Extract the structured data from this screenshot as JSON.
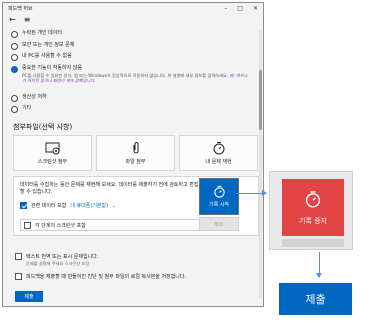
{
  "window": {
    "title": "피드백 허브",
    "controls": [
      "–",
      "□",
      "✕"
    ]
  },
  "nav": {
    "back_icon": "back-arrow-icon",
    "menu_icon": "hamburger-icon"
  },
  "severity": {
    "options": [
      {
        "label": "누락된 개인 데이터",
        "selected": false
      },
      {
        "label": "보안 또는 개인 정보 문제",
        "selected": false
      },
      {
        "label": "내 PC를 사용할 수 없음",
        "selected": false
      },
      {
        "label": "중요한 기능이 작동하지 않음",
        "selected": true,
        "desc": "PC를 사용할 수 있지만 장치, 앱 또는 Windows가 정상적으로 작동하지 않습니다. 위 설명에 세부 정보를 입력하세요.",
        "desc_link": "예: 마우스가 커지지 않거나 화면이 계속 깜빡입니다."
      },
      {
        "label": "생산성 저하",
        "selected": false
      },
      {
        "label": "기타",
        "selected": false
      }
    ]
  },
  "attachments": {
    "title": "첨부파일(선택 사항)",
    "buttons": [
      {
        "label": "스크린샷 첨부",
        "icon": "screenshot-icon"
      },
      {
        "label": "파일 첨부",
        "icon": "file-attach-icon"
      },
      {
        "label": "내 문제 재현",
        "icon": "stopwatch-icon"
      }
    ]
  },
  "recording": {
    "text": "데이터를 수집하는 동안 문제를 재현해 보세요. 데이터를 제출하기 전에 검토하고 편집할 수 있습니다.",
    "check1_label": "관련 데이터 포함",
    "check1_link": "내 휴대폰(기본값)",
    "check1_checked": true,
    "check2_label": "각 단계의 스크린샷 포함",
    "check2_checked": false,
    "start_label": "기록 시작",
    "cancel_label": "취소"
  },
  "consent": {
    "text1": "텍스트 번역 또는 표시 문제입니다.",
    "sub1": "문제를 설명해 주세요 스크린샷 포함",
    "text2": "피드백을 제출할 때 만들어진 진단 및 첨부 파일의 로컬 복사본을 저장합니다.",
    "submit_label": "제출"
  },
  "zoom": {
    "stop_label": "기록 중지",
    "stop_color": "#e24343",
    "submit_label": "제출",
    "accent": "#0067c0"
  }
}
